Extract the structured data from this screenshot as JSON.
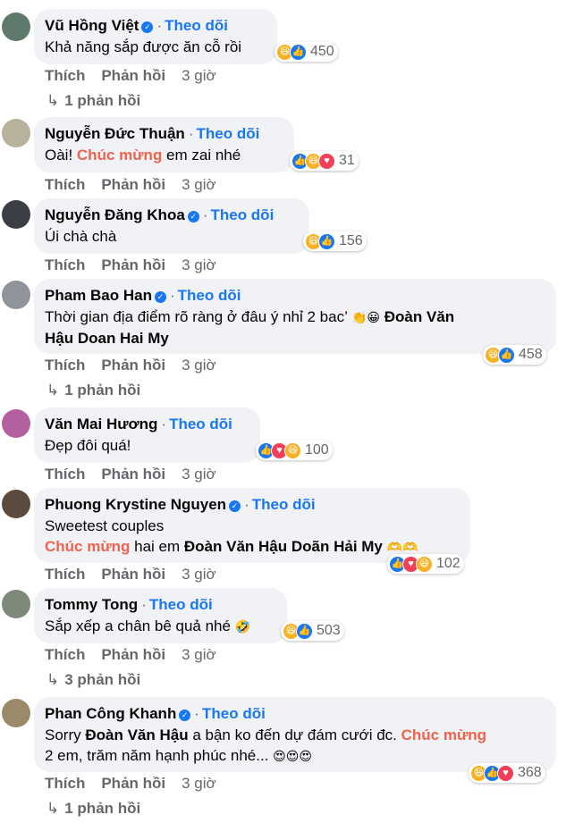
{
  "follow_label": "Theo dõi",
  "separator": "·",
  "actions": {
    "like": "Thích",
    "reply": "Phản hồi"
  },
  "comments": [
    {
      "name": "Vũ Hồng Việt",
      "text": "Khả năng sắp được ăn cỗ rồi",
      "reactions": "450",
      "time": "3 giờ",
      "replies": "1 phản hồi"
    },
    {
      "name": "Nguyễn Đức Thuận",
      "text_a": "Oài! ",
      "highlight": "Chúc mừng",
      "text_b": " em zai nhé",
      "reactions": "31",
      "time": "3 giờ"
    },
    {
      "name": "Nguyễn Đăng Khoa",
      "text": "Úi chà chà",
      "reactions": "156",
      "time": "3 giờ"
    },
    {
      "name": "Pham Bao Han",
      "text_a": "Thời gian địa điểm rõ ràng ở đâu ý nhỉ 2 bac’ ",
      "emoji": "👏😀",
      "tag_a": "Đoàn Văn",
      "tag_b": "Hậu Doan Hai My",
      "reactions": "458",
      "time": "3 giờ",
      "replies": "1 phản hồi"
    },
    {
      "name": "Văn Mai Hương",
      "text": "Đẹp đôi quá!",
      "reactions": "100",
      "time": "3 giờ"
    },
    {
      "name": "Phuong Krystine Nguyen",
      "line1": "Sweetest couples",
      "highlight": "Chúc mừng",
      "text_b": " hai em ",
      "tag": "Đoàn Văn Hậu Doãn Hải My",
      "emoji": "🫶🫶",
      "reactions": "102",
      "time": "3 giờ"
    },
    {
      "name": "Tommy Tong",
      "text": "Sắp xếp a chân bê quả nhé",
      "emoji": "🤣",
      "reactions": "503",
      "time": "3 giờ",
      "replies": "3 phản hồi"
    },
    {
      "name": "Phan Công Khanh",
      "text_a": "Sorry ",
      "tag": "Đoàn Văn Hậu",
      "text_b": " a bận ko đến dự đám cưới đc. ",
      "highlight": "Chúc mừng",
      "line2": "2 em, trăm năm hạnh phúc nhé... ",
      "emoji": "😍😍😍",
      "reactions": "368",
      "time": "3 giờ",
      "replies": "1 phản hồi"
    }
  ],
  "colors": {
    "follow": "#1877f2",
    "highlight": "#f0624c",
    "meta": "#65676b",
    "bubble": "#f0f2f5"
  }
}
